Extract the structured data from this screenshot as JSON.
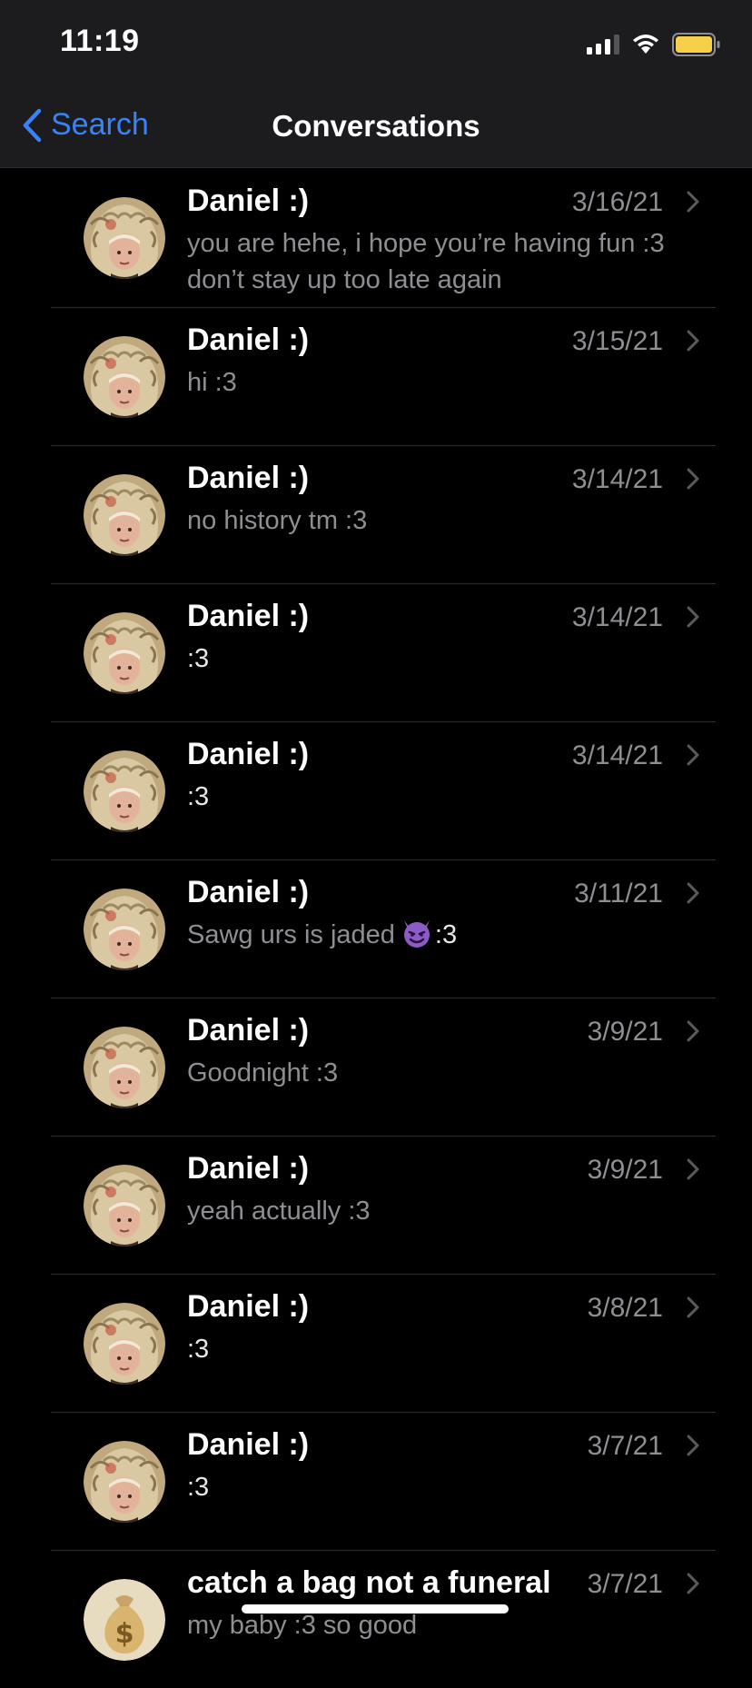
{
  "status_bar": {
    "time": "11:19"
  },
  "nav": {
    "back_label": "Search",
    "title": "Conversations"
  },
  "colors": {
    "accent": "#3a82f7",
    "battery": "#f7d04a",
    "secondary_text": "#8e8e93"
  },
  "conversations": [
    {
      "name": "Daniel :)",
      "date": "3/16/21",
      "preview": "you are hehe, i hope you’re having fun :3 don’t stay up too late again",
      "avatar": "contact-photo"
    },
    {
      "name": "Daniel :)",
      "date": "3/15/21",
      "preview": "hi :3",
      "avatar": "contact-photo"
    },
    {
      "name": "Daniel :)",
      "date": "3/14/21",
      "preview": "no history tm :3",
      "avatar": "contact-photo"
    },
    {
      "name": "Daniel :)",
      "date": "3/14/21",
      "preview": ":3",
      "avatar": "contact-photo"
    },
    {
      "name": "Daniel :)",
      "date": "3/14/21",
      "preview": ":3",
      "avatar": "contact-photo"
    },
    {
      "name": "Daniel :)",
      "date": "3/11/21",
      "preview_before": "Sawg urs is jaded",
      "preview_emoji": "smiling-devil-emoji",
      "preview_after": ":3",
      "avatar": "contact-photo"
    },
    {
      "name": "Daniel :)",
      "date": "3/9/21",
      "preview": "Goodnight :3",
      "avatar": "contact-photo"
    },
    {
      "name": "Daniel :)",
      "date": "3/9/21",
      "preview": "yeah actually :3",
      "avatar": "contact-photo"
    },
    {
      "name": "Daniel :)",
      "date": "3/8/21",
      "preview": ":3",
      "avatar": "contact-photo"
    },
    {
      "name": "Daniel :)",
      "date": "3/7/21",
      "preview": ":3",
      "avatar": "contact-photo"
    },
    {
      "name": "catch a bag not a funeral",
      "date": "3/7/21",
      "preview": "my baby :3 so good",
      "avatar": "money-bag-emoji"
    }
  ]
}
